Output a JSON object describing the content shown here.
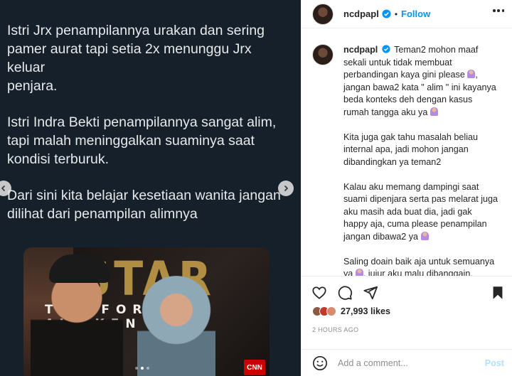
{
  "tweet": {
    "paragraphs": [
      "Istri Jrx penampilannya urakan dan sering\npamer aurat tapi setia 2x menunggu Jrx keluar\npenjara.",
      "Istri Indra Bekti penampilannya sangat alim,\ntapi malah meninggalkan suaminya saat\nkondisi terburuk.",
      "Dari sini kita belajar kesetiaan wanita jangan\ndilihat dari penampilan alimnya"
    ]
  },
  "photo": {
    "star_text": "STAR",
    "awaken_text": "THE FORCE AWAKEN",
    "cnn_text": "CNN"
  },
  "header": {
    "username": "ncdpapl",
    "separator": "•",
    "follow_label": "Follow"
  },
  "caption": {
    "username": "ncdpapl",
    "para1": "Teman2 mohon maaf\nsekali untuk tidak membuat\nperbandingan kaya gini please",
    "para1b": ",\njangan bawa2 kata \" alim \" ini kayanya\nbeda konteks deh dengan kasus\nrumah tangga aku ya",
    "para2": "Kita juga gak tahu masalah beliau\ninternal apa, jadi mohon jangan\ndibandingkan ya teman2",
    "para3": "Kalau aku memang dampingi saat\nsuami dipenjara serta pas melarat juga\naku masih ada buat dia, jadi gak\nhappy aja, cuma please penampilan\njangan dibawa2 ya",
    "para4a": "Saling doain baik aja untuk semuanya\nya",
    "para4b": ", jujur aku malu dibanggain,\nkarena masih banyak perempuan"
  },
  "post": {
    "likes": "27,993 likes",
    "timestamp": "2 HOURS AGO"
  },
  "comment_box": {
    "placeholder": "Add a comment...",
    "post_label": "Post"
  },
  "colors": {
    "media_bg": "#15202b",
    "follow_blue": "#0095f6",
    "verified_blue": "#0095f6",
    "post_disabled": "#b2dffc"
  },
  "icons": [
    "chevron-left-icon",
    "chevron-right-icon",
    "verified-badge-icon",
    "more-icon",
    "heart-icon",
    "comment-icon",
    "share-icon",
    "bookmark-icon",
    "emoji-icon",
    "emoji-woman-icon"
  ]
}
